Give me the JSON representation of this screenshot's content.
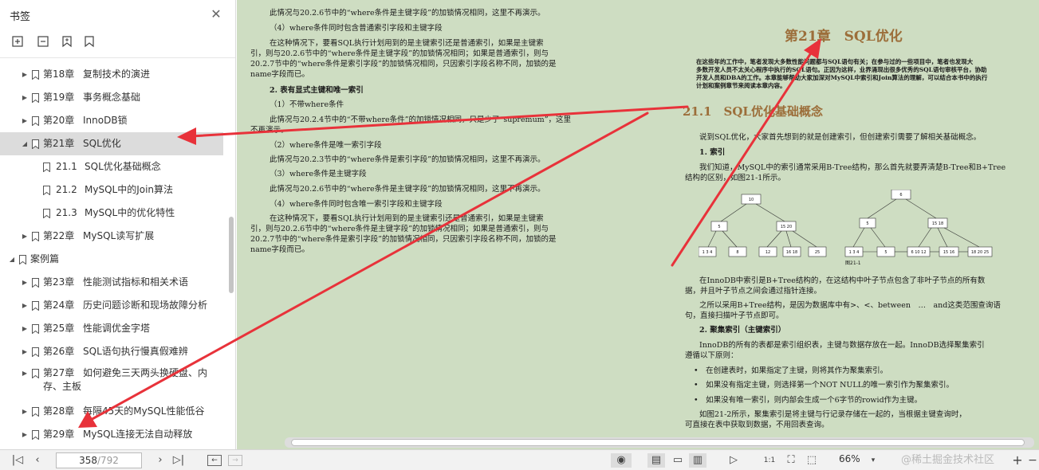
{
  "sidebar": {
    "title": "书签",
    "tree": [
      {
        "chap": "第18章",
        "name": "复制技术的演进",
        "level": 1
      },
      {
        "chap": "第19章",
        "name": "事务概念基础",
        "level": 1
      },
      {
        "chap": "第20章",
        "name": "InnoDB锁",
        "level": 1
      },
      {
        "chap": "第21章",
        "name": "SQL优化",
        "level": 1,
        "expanded": true,
        "selected": true
      },
      {
        "chap": "21.1",
        "name": "SQL优化基础概念",
        "level": 2
      },
      {
        "chap": "21.2",
        "name": "MySQL中的Join算法",
        "level": 2
      },
      {
        "chap": "21.3",
        "name": "MySQL中的优化特性",
        "level": 2
      },
      {
        "chap": "第22章",
        "name": "MySQL读写扩展",
        "level": 1
      },
      {
        "chap": "",
        "name": "案例篇",
        "level": 0,
        "expanded": true
      },
      {
        "chap": "第23章",
        "name": "性能测试指标和相关术语",
        "level": 1
      },
      {
        "chap": "第24章",
        "name": "历史问题诊断和现场故障分析",
        "level": 1
      },
      {
        "chap": "第25章",
        "name": "性能调优金字塔",
        "level": 1
      },
      {
        "chap": "第26章",
        "name": "SQL语句执行慢真假难辨",
        "level": 1
      },
      {
        "chap": "第27章",
        "name": "如何避免三天两头换硬盘、内",
        "name2": "存、主板",
        "level": 1
      },
      {
        "chap": "第28章",
        "name": "每隔45天的MySQL性能低谷",
        "level": 1
      },
      {
        "chap": "第29章",
        "name": "MySQL连接无法自动释放",
        "level": 1
      }
    ]
  },
  "left_page": [
    "此情况与20.2.6节中的“where条件是主键字段”的加锁情况相同，这里不再演示。",
    "（4）where条件同时包含普通索引字段和主键字段",
    "在这种情况下，要看SQL执行计划用到的是主键索引还是普通索引，如果是主键索",
    "引，则与20.2.6节中的“where条件是主键字段”的加锁情况相同；如果是普通索引，则与",
    "20.2.7节中的“where条件是索引字段”的加锁情况相同，只因索引字段名称不同，加锁的是",
    "name字段而已。",
    "2. 表有显式主键和唯一索引",
    "（1）不带where条件",
    "此情况与20.2.4节中的“不带where条件”的加锁情况相同，只是少了“supremum”，这里",
    "不再演示。",
    "（2）where条件是唯一索引字段",
    "此情况与20.2.3节中的“where条件是索引字段”的加锁情况相同，这里不再演示。",
    "（3）where条件是主键字段",
    "此情况与20.2.6节中的“where条件是主键字段”的加锁情况相同，这里不再演示。",
    "（4）where条件同时包含唯一索引字段和主键字段",
    "在这种情况下，要看SQL执行计划用到的是主键索引还是普通索引，如果是主键索",
    "引，则与20.2.6节中的“where条件是主键字段”的加锁情况相同；如果是普通索引，则与",
    "20.2.7节中的“where条件是索引字段”的加锁情况相同，只因索引字段名称不同，加锁的是",
    "name字段而已。"
  ],
  "right_page": {
    "chapter_title": "第21章　SQL优化",
    "intro": [
      "在这些年的工作中，笔者发现大多数性能问题都与SQL语句有关；在参与过的一些项目中，笔者也发现大",
      "多数开发人员不太关心程序中执行的SQL语句。正因为这样，业界涌现出很多优秀的SQL语句审核平台，协助",
      "开发人员和DBA的工作。本章能够帮助大家加深对MySQL中索引和Join算法的理解，可以结合本书中的执行",
      "计划和案例章节来阅读本章内容。"
    ],
    "section_title": "21.1　SQL优化基础概念",
    "p1": "说到SQL优化，大家首先想到的就是创建索引，但创建索引需要了解相关基础概念。",
    "h1": "1. 索引",
    "p2a": "我们知道，MySQL中的索引通常采用B-Tree结构，那么首先就要弄清楚B-Tree和B+Tree",
    "p2b": "结构的区别，如图21-1所示。",
    "fig_caption": "图21-1",
    "p3a": "在InnoDB中索引是B+Tree结构的，在这结构中叶子节点包含了非叶子节点的所有数",
    "p3b": "据，并且叶子节点之间会通过指针连接。",
    "p4a": "之所以采用B+Tree结构，是因为数据库中有>、<、between　…　and这类范围查询语",
    "p4b": "句，直接扫描叶子节点即可。",
    "h2": "2. 聚集索引（主键索引）",
    "p5a": "InnoDB的所有的表都是索引组织表，主键与数据存放在一起。InnoDB选择聚集索引",
    "p5b": "遵循以下原则：",
    "b1": "在创建表时，如果指定了主键，则将其作为聚集索引。",
    "b2": "如果没有指定主键，则选择第一个NOT NULL的唯一索引作为聚集索引。",
    "b3": "如果没有唯一索引，则内部会生成一个6字节的rowid作为主键。",
    "p6a": "如图21-2所示，聚集索引是将主键与行记录存储在一起的，当根据主键查询时，",
    "p6b": "可直接在表中获取到数据，不用回表查询。"
  },
  "btree": {
    "left": {
      "root": "10",
      "mid": [
        "5",
        "15 20"
      ],
      "leaves": [
        "1 3 4",
        "8",
        "12",
        "16 18",
        "25"
      ]
    },
    "right": {
      "root": "6",
      "mid": [
        "5",
        "15 18"
      ],
      "leaves": [
        "1 3 4",
        "5",
        "6 10 12",
        "15 16",
        "18 20 25"
      ]
    }
  },
  "status": {
    "page_current": "358",
    "page_total": "/792",
    "zoom": "66%",
    "watermark": "@稀土掘金技术社区"
  },
  "colors": {
    "doc_bg": "#ceddc2",
    "heading": "#9c6e3a",
    "arrow": "#e8323a"
  }
}
